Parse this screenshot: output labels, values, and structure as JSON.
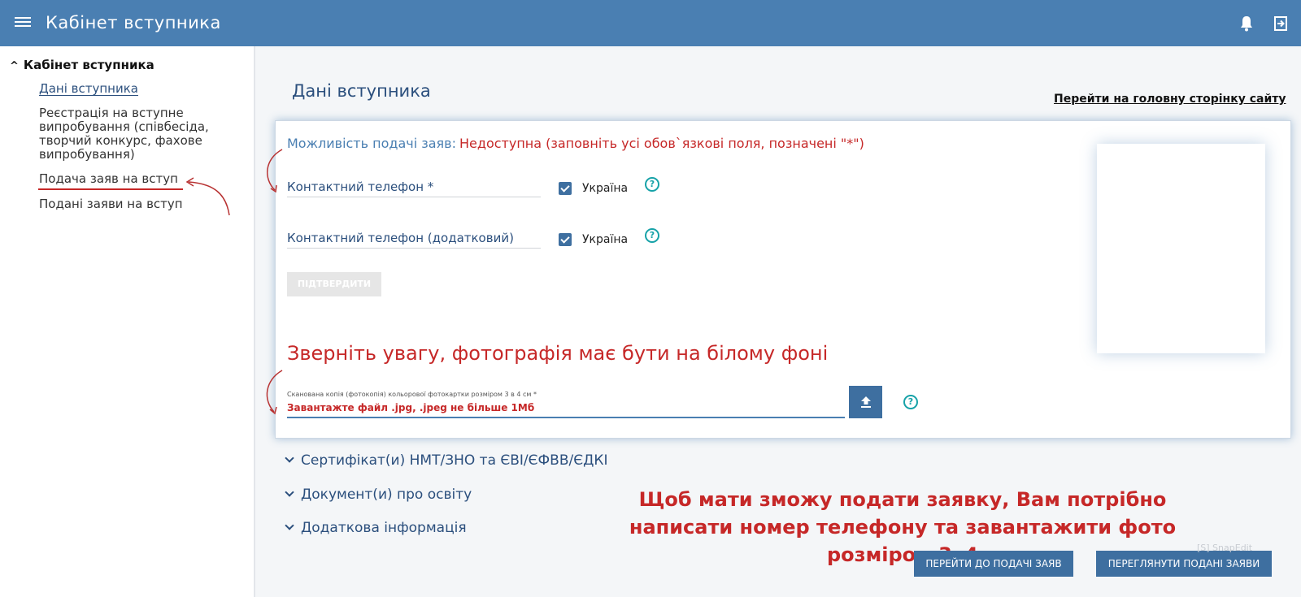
{
  "header": {
    "title": "Кабінет вступника"
  },
  "sidebar": {
    "section_title": "Кабінет вступника",
    "items": [
      {
        "label": "Дані вступника"
      },
      {
        "label": "Реєстрація на вступне випробування (співбесіда, творчий конкурс, фахове випробування)"
      },
      {
        "label": "Подача заяв на вступ"
      },
      {
        "label": "Подані заяви на вступ"
      }
    ]
  },
  "main": {
    "title": "Дані вступника",
    "home_link": "Перейти на головну сторінку сайту",
    "availability_label": "Можливість подачі заяв:",
    "availability_status": "Недоступна (заповніть усі обов`язкові поля, позначені \"*\")",
    "phone_label": "Контактний телефон *",
    "phone_extra_label": "Контактний телефон (додатковий)",
    "country_label": "Україна",
    "confirm_label": "ПІДТВЕРДИТИ",
    "photo_warning": "Зверніть увагу, фотографія має бути на білому фоні",
    "file_label": "Сканована копія (фотокопія) кольорової фотокартки розміром 3 в 4 см *",
    "file_placeholder": "Завантажте файл .jpg, .jpeg не більше 1Мб",
    "help_symbol": "?"
  },
  "accordions": [
    {
      "label": "Сертифікат(и) НМТ/ЗНО та ЄВІ/ЄФВВ/ЄДКІ"
    },
    {
      "label": "Документ(и) про освіту"
    },
    {
      "label": "Додаткова інформація"
    }
  ],
  "instruction": "Щоб мати зможу подати заявку, Вам потрібно написати номер телефону та завантажити фото розміром 3х4",
  "actions": {
    "go_to_applications": "ПЕРЕЙТИ ДО ПОДАЧІ ЗАЯВ",
    "view_applications": "ПЕРЕГЛЯНУТИ ПОДАНІ ЗАЯВИ"
  },
  "watermark": "[S] SnapEdit",
  "colors": {
    "header_bg": "#4a7fb2",
    "accent": "#3e6fa0",
    "warning": "#c62828",
    "help": "#17a2a8"
  }
}
